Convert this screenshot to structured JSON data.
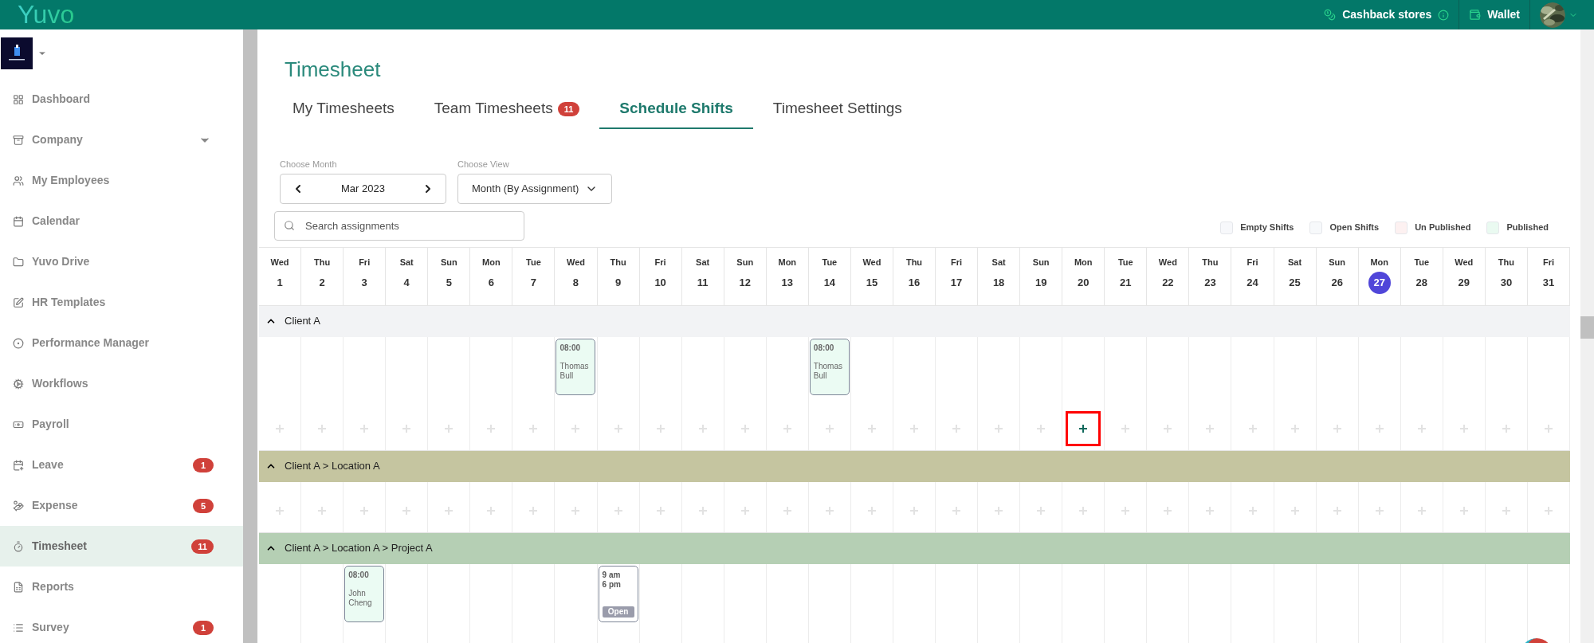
{
  "topbar": {
    "logo": "Yuvo",
    "links": [
      {
        "label": "Cashback stores",
        "info": true
      },
      {
        "label": "Wallet",
        "info": false
      }
    ]
  },
  "sidebar": {
    "items": [
      {
        "label": "Dashboard",
        "selected": false
      },
      {
        "label": "Company",
        "selected": false,
        "expandable": true
      },
      {
        "label": "My Employees",
        "selected": false
      },
      {
        "label": "Calendar",
        "selected": false
      },
      {
        "label": "Yuvo Drive",
        "selected": false
      },
      {
        "label": "HR Templates",
        "selected": false
      },
      {
        "label": "Performance Manager",
        "selected": false
      },
      {
        "label": "Workflows",
        "selected": false
      },
      {
        "label": "Payroll",
        "selected": false
      },
      {
        "label": "Leave",
        "selected": false,
        "badge": "1"
      },
      {
        "label": "Expense",
        "selected": false,
        "badge": "5"
      },
      {
        "label": "Timesheet",
        "selected": true,
        "badge": "11"
      },
      {
        "label": "Reports",
        "selected": false
      },
      {
        "label": "Survey",
        "selected": false,
        "badge": "1"
      }
    ]
  },
  "page_title": "Timesheet",
  "tabs": [
    {
      "label": "My Timesheets",
      "selected": false
    },
    {
      "label": "Team Timesheets",
      "selected": false,
      "badge": "11"
    },
    {
      "label": "Schedule Shifts",
      "selected": true
    },
    {
      "label": "Timesheet Settings",
      "selected": false
    }
  ],
  "month_picker": {
    "label": "Choose Month",
    "value": "Mar 2023"
  },
  "view_select": {
    "label": "Choose View",
    "value": "Month (By Assignment)"
  },
  "search": {
    "placeholder": "Search assignments"
  },
  "legend": [
    {
      "label": "Empty Shifts",
      "color": "#f7f8fb"
    },
    {
      "label": "Open Shifts",
      "color": "#f7f9fb"
    },
    {
      "label": "Un Published",
      "color": "#fdf1f1"
    },
    {
      "label": "Published",
      "color": "#eafaf1"
    }
  ],
  "days": [
    {
      "weekday": "Wed",
      "date": "1",
      "today": false
    },
    {
      "weekday": "Thu",
      "date": "2",
      "today": false
    },
    {
      "weekday": "Fri",
      "date": "3",
      "today": false
    },
    {
      "weekday": "Sat",
      "date": "4",
      "today": false
    },
    {
      "weekday": "Sun",
      "date": "5",
      "today": false
    },
    {
      "weekday": "Mon",
      "date": "6",
      "today": false
    },
    {
      "weekday": "Tue",
      "date": "7",
      "today": false
    },
    {
      "weekday": "Wed",
      "date": "8",
      "today": false
    },
    {
      "weekday": "Thu",
      "date": "9",
      "today": false
    },
    {
      "weekday": "Fri",
      "date": "10",
      "today": false
    },
    {
      "weekday": "Sat",
      "date": "11",
      "today": false
    },
    {
      "weekday": "Sun",
      "date": "12",
      "today": false
    },
    {
      "weekday": "Mon",
      "date": "13",
      "today": false
    },
    {
      "weekday": "Tue",
      "date": "14",
      "today": false
    },
    {
      "weekday": "Wed",
      "date": "15",
      "today": false
    },
    {
      "weekday": "Thu",
      "date": "16",
      "today": false
    },
    {
      "weekday": "Fri",
      "date": "17",
      "today": false
    },
    {
      "weekday": "Sat",
      "date": "18",
      "today": false
    },
    {
      "weekday": "Sun",
      "date": "19",
      "today": false
    },
    {
      "weekday": "Mon",
      "date": "20",
      "today": false
    },
    {
      "weekday": "Tue",
      "date": "21",
      "today": false
    },
    {
      "weekday": "Wed",
      "date": "22",
      "today": false
    },
    {
      "weekday": "Thu",
      "date": "23",
      "today": false
    },
    {
      "weekday": "Fri",
      "date": "24",
      "today": false
    },
    {
      "weekday": "Sat",
      "date": "25",
      "today": false
    },
    {
      "weekday": "Sun",
      "date": "26",
      "today": false
    },
    {
      "weekday": "Mon",
      "date": "27",
      "today": true
    },
    {
      "weekday": "Tue",
      "date": "28",
      "today": false
    },
    {
      "weekday": "Wed",
      "date": "29",
      "today": false
    },
    {
      "weekday": "Thu",
      "date": "30",
      "today": false
    },
    {
      "weekday": "Fri",
      "date": "31",
      "today": false
    }
  ],
  "groups": [
    {
      "title": "Client A",
      "color": "#f2f3f5",
      "add_row": true,
      "expanded": true,
      "slots": [
        {
          "highlighted": false
        },
        {
          "highlighted": false
        },
        {
          "highlighted": false
        },
        {
          "highlighted": false
        },
        {
          "highlighted": false
        },
        {
          "highlighted": false
        },
        {
          "highlighted": false
        },
        {
          "highlighted": false,
          "shift": {
            "kind": "assigned",
            "time": "08:00",
            "name": "Thomas Bull"
          }
        },
        {
          "highlighted": false
        },
        {
          "highlighted": false
        },
        {
          "highlighted": false
        },
        {
          "highlighted": false
        },
        {
          "highlighted": false
        },
        {
          "highlighted": false,
          "shift": {
            "kind": "assigned",
            "time": "08:00",
            "name": "Thomas Bull"
          }
        },
        {
          "highlighted": false
        },
        {
          "highlighted": false
        },
        {
          "highlighted": false
        },
        {
          "highlighted": false
        },
        {
          "highlighted": false
        },
        {
          "highlighted": true
        },
        {
          "highlighted": false
        },
        {
          "highlighted": false
        },
        {
          "highlighted": false
        },
        {
          "highlighted": false
        },
        {
          "highlighted": false
        },
        {
          "highlighted": false
        },
        {
          "highlighted": false
        },
        {
          "highlighted": false
        },
        {
          "highlighted": false
        },
        {
          "highlighted": false
        },
        {
          "highlighted": false
        }
      ]
    },
    {
      "title": "Client A > Location A",
      "color": "#c5c5a0",
      "add_row": true,
      "expanded": true,
      "slots": [
        {
          "highlighted": false
        },
        {
          "highlighted": false
        },
        {
          "highlighted": false
        },
        {
          "highlighted": false
        },
        {
          "highlighted": false
        },
        {
          "highlighted": false
        },
        {
          "highlighted": false
        },
        {
          "highlighted": false
        },
        {
          "highlighted": false
        },
        {
          "highlighted": false
        },
        {
          "highlighted": false
        },
        {
          "highlighted": false
        },
        {
          "highlighted": false
        },
        {
          "highlighted": false
        },
        {
          "highlighted": false
        },
        {
          "highlighted": false
        },
        {
          "highlighted": false
        },
        {
          "highlighted": false
        },
        {
          "highlighted": false
        },
        {
          "highlighted": false
        },
        {
          "highlighted": false
        },
        {
          "highlighted": false
        },
        {
          "highlighted": false
        },
        {
          "highlighted": false
        },
        {
          "highlighted": false
        },
        {
          "highlighted": false
        },
        {
          "highlighted": false
        },
        {
          "highlighted": false
        },
        {
          "highlighted": false
        },
        {
          "highlighted": false
        },
        {
          "highlighted": false
        }
      ]
    },
    {
      "title": "Client A > Location A > Project A",
      "color": "#b5cfb4",
      "add_row": false,
      "expanded": true,
      "slots": [
        {
          "highlighted": false
        },
        {
          "highlighted": false
        },
        {
          "highlighted": false,
          "shift": {
            "kind": "assigned",
            "time": "08:00",
            "name": "John Cheng"
          }
        },
        {
          "highlighted": false
        },
        {
          "highlighted": false
        },
        {
          "highlighted": false
        },
        {
          "highlighted": false
        },
        {
          "highlighted": false
        },
        {
          "highlighted": false,
          "shift": {
            "kind": "open",
            "start": "9 am",
            "end": "6 pm",
            "badge": "Open"
          }
        },
        {
          "highlighted": false
        },
        {
          "highlighted": false
        },
        {
          "highlighted": false
        },
        {
          "highlighted": false
        },
        {
          "highlighted": false
        },
        {
          "highlighted": false
        },
        {
          "highlighted": false
        },
        {
          "highlighted": false
        },
        {
          "highlighted": false
        },
        {
          "highlighted": false
        },
        {
          "highlighted": false
        },
        {
          "highlighted": false
        },
        {
          "highlighted": false
        },
        {
          "highlighted": false
        },
        {
          "highlighted": false
        },
        {
          "highlighted": false
        },
        {
          "highlighted": false
        },
        {
          "highlighted": false
        },
        {
          "highlighted": false
        },
        {
          "highlighted": false
        },
        {
          "highlighted": false
        },
        {
          "highlighted": false
        }
      ]
    }
  ]
}
